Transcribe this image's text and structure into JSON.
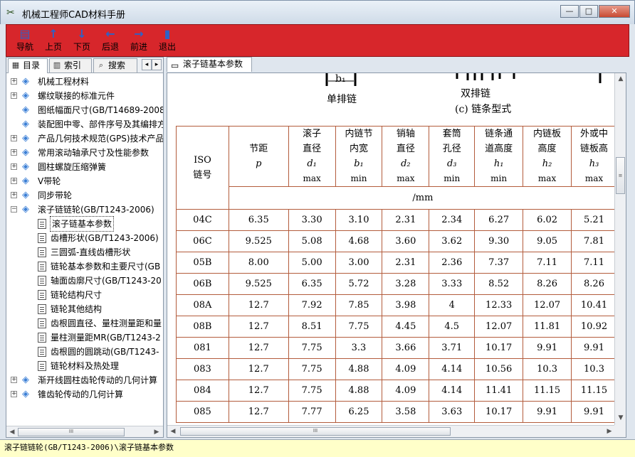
{
  "window": {
    "title": "机械工程师CAD材料手册",
    "minimize": "—",
    "maximize": "□",
    "close": "✕"
  },
  "toolbar": [
    {
      "name": "nav-button",
      "icon": "▤",
      "label": "导航"
    },
    {
      "name": "prev-page-button",
      "icon": "↑",
      "label": "上页"
    },
    {
      "name": "next-page-button",
      "icon": "↓",
      "label": "下页"
    },
    {
      "name": "back-button",
      "icon": "←",
      "label": "后退"
    },
    {
      "name": "forward-button",
      "icon": "→",
      "label": "前进"
    },
    {
      "name": "exit-button",
      "icon": "▮",
      "label": "退出"
    }
  ],
  "left_tabs": {
    "contents": "目录",
    "index": "索引",
    "search": "搜索",
    "prev": "◂",
    "next": "▸"
  },
  "tree": [
    {
      "label": "机械工程材料",
      "level": 0,
      "type": "book",
      "expander": "+"
    },
    {
      "label": "螺纹联接的标准元件",
      "level": 0,
      "type": "book",
      "expander": "+"
    },
    {
      "label": "图纸幅面尺寸(GB/T14689-2008",
      "level": 0,
      "type": "book",
      "expander": ""
    },
    {
      "label": "装配图中零、部件序号及其编排方",
      "level": 0,
      "type": "book",
      "expander": ""
    },
    {
      "label": "产品几何技术规范(GPS)技术产品",
      "level": 0,
      "type": "book",
      "expander": "+"
    },
    {
      "label": "常用滚动轴承尺寸及性能参数",
      "level": 0,
      "type": "book",
      "expander": "+"
    },
    {
      "label": "圆柱螺旋压缩弹簧",
      "level": 0,
      "type": "book",
      "expander": "+"
    },
    {
      "label": "V带轮",
      "level": 0,
      "type": "book",
      "expander": "+"
    },
    {
      "label": "同步带轮",
      "level": 0,
      "type": "book",
      "expander": "+"
    },
    {
      "label": "滚子链链轮(GB/T1243-2006)",
      "level": 0,
      "type": "book",
      "expander": "−"
    },
    {
      "label": "滚子链基本参数",
      "level": 1,
      "type": "doc",
      "selected": true
    },
    {
      "label": "齿槽形状(GB/T1243-2006)",
      "level": 1,
      "type": "doc"
    },
    {
      "label": "三圆弧-直线齿槽形状",
      "level": 1,
      "type": "doc"
    },
    {
      "label": "链轮基本参数和主要尺寸(GB",
      "level": 1,
      "type": "doc"
    },
    {
      "label": "轴面齿廓尺寸(GB/T1243-20",
      "level": 1,
      "type": "doc"
    },
    {
      "label": "链轮结构尺寸",
      "level": 1,
      "type": "doc"
    },
    {
      "label": "链轮其他结构",
      "level": 1,
      "type": "doc"
    },
    {
      "label": "齿根圆直径、量柱测量距和量",
      "level": 1,
      "type": "doc"
    },
    {
      "label": "量柱测量距MR(GB/T1243-2",
      "level": 1,
      "type": "doc"
    },
    {
      "label": "齿根圆的圆跳动(GB/T1243-",
      "level": 1,
      "type": "doc"
    },
    {
      "label": "链轮材料及热处理",
      "level": 1,
      "type": "doc"
    },
    {
      "label": "渐开线圆柱齿轮传动的几何计算",
      "level": 0,
      "type": "book",
      "expander": "+"
    },
    {
      "label": "锥齿轮传动的几何计算",
      "level": 0,
      "type": "book",
      "expander": "+"
    }
  ],
  "content_tab": "滚子链基本参数",
  "figure": {
    "b1": "b₁",
    "single": "单排链",
    "double": "双排链",
    "caption": "(c) 链条型式"
  },
  "table": {
    "headers": [
      {
        "title": "ISO\n链号",
        "sym": "",
        "lim": ""
      },
      {
        "title": "节距",
        "sym": "p",
        "lim": ""
      },
      {
        "title": "滚子\n直径",
        "sym": "d₁",
        "lim": "max"
      },
      {
        "title": "内链节\n内宽",
        "sym": "b₁",
        "lim": "min"
      },
      {
        "title": "销轴\n直径",
        "sym": "d₂",
        "lim": "max"
      },
      {
        "title": "套筒\n孔径",
        "sym": "d₃",
        "lim": "min"
      },
      {
        "title": "链条通\n道高度",
        "sym": "h₁",
        "lim": "min"
      },
      {
        "title": "内链板\n高度",
        "sym": "h₂",
        "lim": "max"
      },
      {
        "title": "外或中\n链板高",
        "sym": "h₃",
        "lim": "max"
      }
    ],
    "unit": "/mm",
    "rows": [
      [
        "04C",
        "6.35",
        "3.30",
        "3.10",
        "2.31",
        "2.34",
        "6.27",
        "6.02",
        "5.21"
      ],
      [
        "06C",
        "9.525",
        "5.08",
        "4.68",
        "3.60",
        "3.62",
        "9.30",
        "9.05",
        "7.81"
      ],
      [
        "05B",
        "8.00",
        "5.00",
        "3.00",
        "2.31",
        "2.36",
        "7.37",
        "7.11",
        "7.11"
      ],
      [
        "06B",
        "9.525",
        "6.35",
        "5.72",
        "3.28",
        "3.33",
        "8.52",
        "8.26",
        "8.26"
      ],
      [
        "08A",
        "12.7",
        "7.92",
        "7.85",
        "3.98",
        "4",
        "12.33",
        "12.07",
        "10.41"
      ],
      [
        "08B",
        "12.7",
        "8.51",
        "7.75",
        "4.45",
        "4.5",
        "12.07",
        "11.81",
        "10.92"
      ],
      [
        "081",
        "12.7",
        "7.75",
        "3.3",
        "3.66",
        "3.71",
        "10.17",
        "9.91",
        "9.91"
      ],
      [
        "083",
        "12.7",
        "7.75",
        "4.88",
        "4.09",
        "4.14",
        "10.56",
        "10.3",
        "10.3"
      ],
      [
        "084",
        "12.7",
        "7.75",
        "4.88",
        "4.09",
        "4.14",
        "11.41",
        "11.15",
        "11.15"
      ],
      [
        "085",
        "12.7",
        "7.77",
        "6.25",
        "3.58",
        "3.63",
        "10.17",
        "9.91",
        "9.91"
      ]
    ]
  },
  "status": "滚子链链轮(GB/T1243-2006)\\滚子链基本参数",
  "colors": {
    "toolbar": "#d7262b",
    "table_border": "#b35c3c",
    "status_bg": "#ffffc9"
  }
}
